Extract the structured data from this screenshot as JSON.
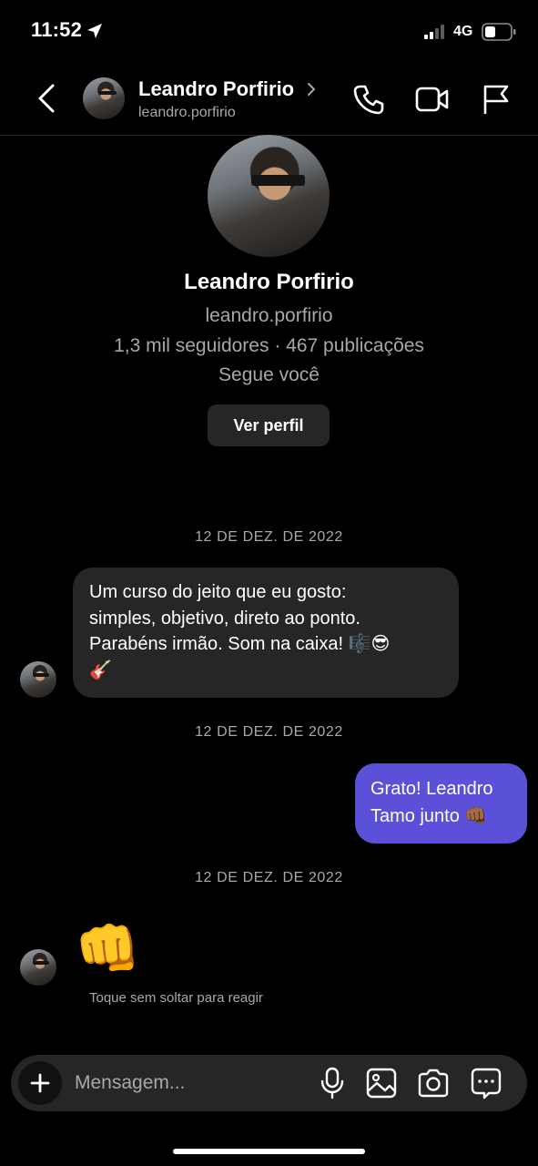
{
  "status_bar": {
    "time": "11:52",
    "network": "4G",
    "icons": [
      "location-arrow-icon",
      "signal-icon",
      "battery-icon"
    ]
  },
  "header": {
    "name": "Leandro Porfirio",
    "username": "leandro.porfirio",
    "icons": [
      "back-icon",
      "chevron-right-icon",
      "phone-icon",
      "video-icon",
      "flag-icon"
    ]
  },
  "profile": {
    "name": "Leandro Porfirio",
    "username": "leandro.porfirio",
    "stats": "1,3 mil seguidores · 467 publicações",
    "follows_you": "Segue você",
    "view_profile_label": "Ver perfil"
  },
  "messages": [
    {
      "date": "12 DE DEZ. DE 2022",
      "from": "them",
      "lines": [
        "Um curso do jeito que eu gosto:",
        "simples, objetivo, direto ao ponto.",
        "Parabéns irmão. Som na caixa! 🎼😎",
        "🎸"
      ]
    },
    {
      "date": "12 DE DEZ. DE 2022",
      "from": "me",
      "lines": [
        "Grato! Leandro",
        "Tamo junto 👊🏾"
      ]
    },
    {
      "date": "12 DE DEZ. DE 2022",
      "from": "them",
      "emoji": "👊",
      "hint": "Toque sem soltar para reagir"
    }
  ],
  "composer": {
    "placeholder": "Mensagem...",
    "icons": [
      "plus-icon",
      "microphone-icon",
      "gallery-icon",
      "camera-icon",
      "sticker-icon"
    ]
  },
  "colors": {
    "background": "#000000",
    "bubble_incoming": "#262626",
    "bubble_outgoing": "#5b51d8",
    "secondary_text": "#a8a8a8"
  }
}
